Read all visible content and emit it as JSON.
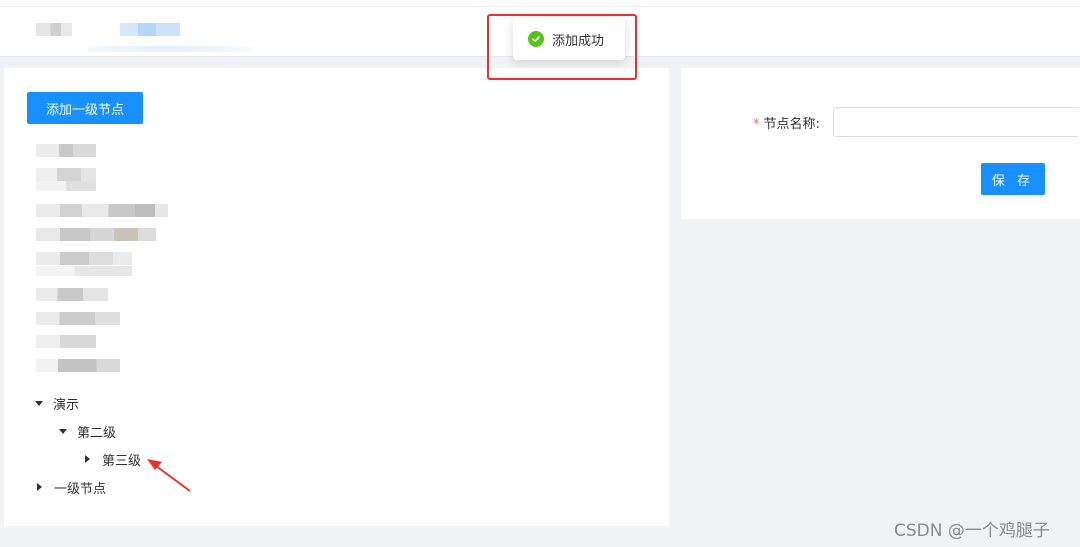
{
  "toast": {
    "message": "添加成功",
    "icon": "check-circle-icon"
  },
  "tree_panel": {
    "add_root_label": "添加一级节点",
    "nodes": [
      {
        "label": "演示",
        "expanded": true,
        "level": 1
      },
      {
        "label": "第二级",
        "expanded": true,
        "level": 2
      },
      {
        "label": "第三级",
        "expanded": false,
        "level": 3
      },
      {
        "label": "一级节点",
        "expanded": false,
        "level": 1
      }
    ]
  },
  "form": {
    "name_label": "节点名称:",
    "required_mark": "*",
    "name_value": "",
    "save_label": "保 存"
  },
  "watermark": "CSDN @一个鸡腿子",
  "colors": {
    "primary": "#1890ff",
    "success": "#52c41a",
    "annotation": "#e8322b",
    "required": "#f56c6c"
  }
}
